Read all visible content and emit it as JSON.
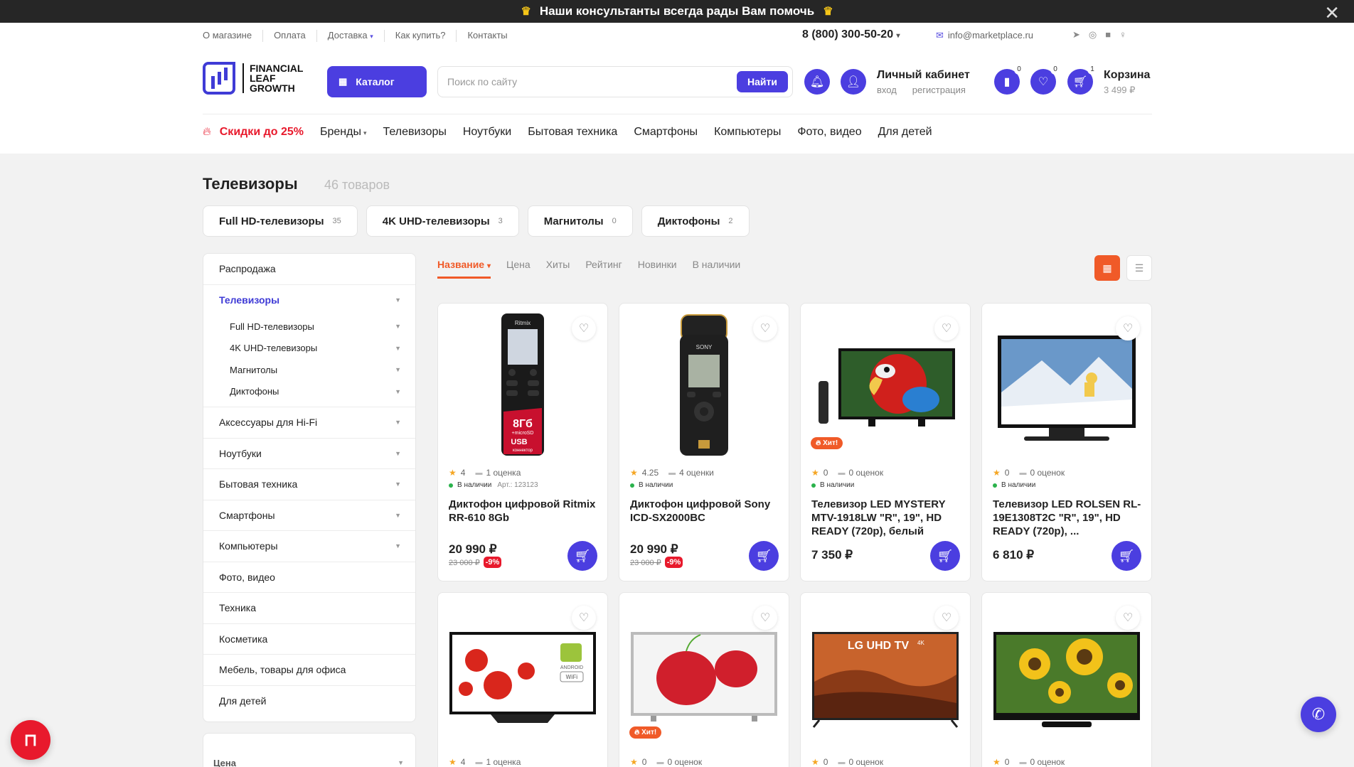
{
  "banner": {
    "text": "Наши консультанты всегда рады Вам помочь"
  },
  "toplinks": [
    "О магазине",
    "Оплата",
    "Доставка",
    "Как купить?",
    "Контакты"
  ],
  "contacts": {
    "phone": "8 (800) 300-50-20",
    "email": "info@marketplace.ru"
  },
  "logo": {
    "line1": "FINANCIAL",
    "line2": "LEAF",
    "line3": "GROWTH"
  },
  "catalog_label": "Каталог",
  "search": {
    "placeholder": "Поиск по сайту",
    "button": "Найти"
  },
  "account": {
    "title": "Личный кабинет",
    "login": "вход",
    "register": "регистрация"
  },
  "counters": {
    "compare": "0",
    "favorites": "0",
    "cart": "1"
  },
  "cart": {
    "title": "Корзина",
    "sum": "3 499 ₽"
  },
  "mainnav": {
    "sale": "Скидки до 25%",
    "items": [
      "Бренды",
      "Телевизоры",
      "Ноутбуки",
      "Бытовая техника",
      "Смартфоны",
      "Компьютеры",
      "Фото, видео",
      "Для детей"
    ]
  },
  "page": {
    "title": "Телевизоры",
    "count": "46 товаров"
  },
  "chips": [
    {
      "label": "Full HD-телевизоры",
      "count": "35"
    },
    {
      "label": "4K UHD-телевизоры",
      "count": "3"
    },
    {
      "label": "Магнитолы",
      "count": "0"
    },
    {
      "label": "Диктофоны",
      "count": "2"
    }
  ],
  "sidebar": {
    "first": "Распродажа",
    "active": "Телевизоры",
    "sub": [
      "Full HD-телевизоры",
      "4K UHD-телевизоры",
      "Магнитолы",
      "Диктофоны"
    ],
    "rest": [
      "Аксессуары для Hi-Fi",
      "Ноутбуки",
      "Бытовая техника",
      "Смартфоны",
      "Компьютеры",
      "Фото, видео",
      "Техника",
      "Косметика",
      "Мебель, товары для офиса",
      "Для детей"
    ],
    "filter_title": "Цена"
  },
  "sort": {
    "items": [
      "Название",
      "Цена",
      "Хиты",
      "Рейтинг",
      "Новинки",
      "В наличии"
    ]
  },
  "products": [
    {
      "rating": "4",
      "reviews": "1 оценка",
      "stock": "В наличии",
      "art": "Арт.: 123123",
      "name": "Диктофон цифровой Ritmix RR-610 8Gb",
      "price": "20 990 ₽",
      "old": "23 000 ₽",
      "discount": "-9%",
      "hit": ""
    },
    {
      "rating": "4.25",
      "reviews": "4 оценки",
      "stock": "В наличии",
      "art": "",
      "name": "Диктофон цифровой Sony ICD-SX2000BC",
      "price": "20 990 ₽",
      "old": "23 000 ₽",
      "discount": "-9%",
      "hit": ""
    },
    {
      "rating": "0",
      "reviews": "0 оценок",
      "stock": "В наличии",
      "art": "",
      "name": "Телевизор LED MYSTERY MTV-1918LW \"R\", 19\", HD READY (720p), белый",
      "price": "7 350 ₽",
      "old": "",
      "discount": "",
      "hit": "Хит!"
    },
    {
      "rating": "0",
      "reviews": "0 оценок",
      "stock": "В наличии",
      "art": "",
      "name": "Телевизор LED ROLSEN RL-19E1308T2C \"R\", 19\", HD READY (720p), ...",
      "price": "6 810 ₽",
      "old": "",
      "discount": "",
      "hit": ""
    },
    {
      "rating": "4",
      "reviews": "1 оценка",
      "hit": ""
    },
    {
      "rating": "0",
      "reviews": "0 оценок",
      "hit": "Хит!"
    },
    {
      "rating": "0",
      "reviews": "0 оценок",
      "hit": ""
    },
    {
      "rating": "0",
      "reviews": "0 оценок",
      "hit": ""
    }
  ],
  "product_images": {
    "p1_brand": "Ritmix",
    "p1_capacity": "8Гб",
    "p1_sd": "+microSD",
    "p1_usb": "USB",
    "p1_usb_sub": "коннектор",
    "p2_brand": "SONY",
    "p6_os": "ANDROID",
    "p6_wifi": "WiFi",
    "p7_brand": "LG UHD TV",
    "p7_res": "4K"
  },
  "colors": {
    "accent": "#4b3ee0",
    "orange": "#f05a28",
    "red": "#e8192c"
  }
}
